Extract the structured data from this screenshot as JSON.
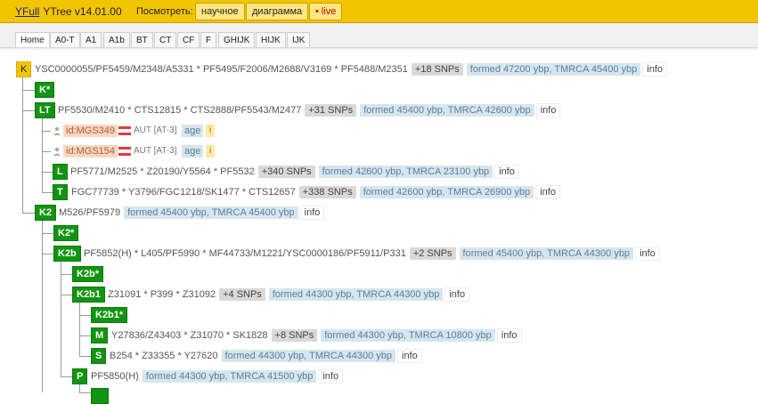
{
  "header": {
    "brand": "YFull",
    "version": "YTree v14.01.00",
    "view_label": "Посмотреть:",
    "buttons": {
      "scientific": "научное",
      "diagram": "диаграмма",
      "live": "• live"
    },
    "colors": {
      "bar": "#f2c500",
      "live": "#c00000"
    }
  },
  "tabs": [
    "Home",
    "A0-T",
    "A1",
    "A1b",
    "BT",
    "CT",
    "CF",
    "F",
    "GHIJK",
    "HIJK",
    "IJK"
  ],
  "active_tab": "Home",
  "tree": {
    "K": {
      "label": "K",
      "snps": "YSC0000055/PF5459/M2348/A5331 * PF5495/F2006/M2688/V3169 * PF5488/M2351",
      "count": "+18 SNPs",
      "formed": "formed 47200 ybp, TMRCA 45400 ybp",
      "info": "info"
    },
    "Kstar": {
      "label": "K*"
    },
    "LT": {
      "label": "LT",
      "snps": "PF5530/M2410 * CTS12815 * CTS2888/PF5543/M2477",
      "count": "+31 SNPs",
      "formed": "formed 45400 ybp, TMRCA 42600 ybp",
      "info": "info"
    },
    "samples": [
      {
        "id": "id:MGS349",
        "country": "AUT [AT-3]",
        "age": "age",
        "i": "i"
      },
      {
        "id": "id:MGS154",
        "country": "AUT [AT-3]",
        "age": "age",
        "i": "i"
      }
    ],
    "L": {
      "label": "L",
      "snps": "PF5771/M2525 * Z20190/Y5564 * PF5532",
      "count": "+340 SNPs",
      "formed": "formed 42600 ybp, TMRCA 23100 ybp",
      "info": "info"
    },
    "T": {
      "label": "T",
      "snps": "FGC77739 * Y3796/FGC1218/SK1477 * CTS12657",
      "count": "+338 SNPs",
      "formed": "formed 42600 ybp, TMRCA 26900 ybp",
      "info": "info"
    },
    "K2": {
      "label": "K2",
      "snps": "M526/PF5979",
      "formed": "formed 45400 ybp, TMRCA 45400 ybp",
      "info": "info"
    },
    "K2star": {
      "label": "K2*"
    },
    "K2b": {
      "label": "K2b",
      "snps": "PF5852(H) * L405/PF5990 * MF44733/M1221/YSC0000186/PF5911/P331",
      "count": "+2 SNPs",
      "formed": "formed 45400 ybp, TMRCA 44300 ybp",
      "info": "info"
    },
    "K2bstar": {
      "label": "K2b*"
    },
    "K2b1": {
      "label": "K2b1",
      "snps": "Z31091 * P399 * Z31092",
      "count": "+4 SNPs",
      "formed": "formed 44300 ybp, TMRCA 44300 ybp",
      "info": "info"
    },
    "K2b1star": {
      "label": "K2b1*"
    },
    "M": {
      "label": "M",
      "snps": "Y27836/Z43403 * Z31070 * SK1828",
      "count": "+8 SNPs",
      "formed": "formed 44300 ybp, TMRCA 10800 ybp",
      "info": "info"
    },
    "S": {
      "label": "S",
      "snps": "B254 * Z33355 * Y27620",
      "formed": "formed 44300 ybp, TMRCA 44300 ybp",
      "info": "info"
    },
    "P": {
      "label": "P",
      "snps": "PF5850(H)",
      "formed": "formed 44300 ybp, TMRCA 41500 ybp",
      "info": "info"
    }
  }
}
